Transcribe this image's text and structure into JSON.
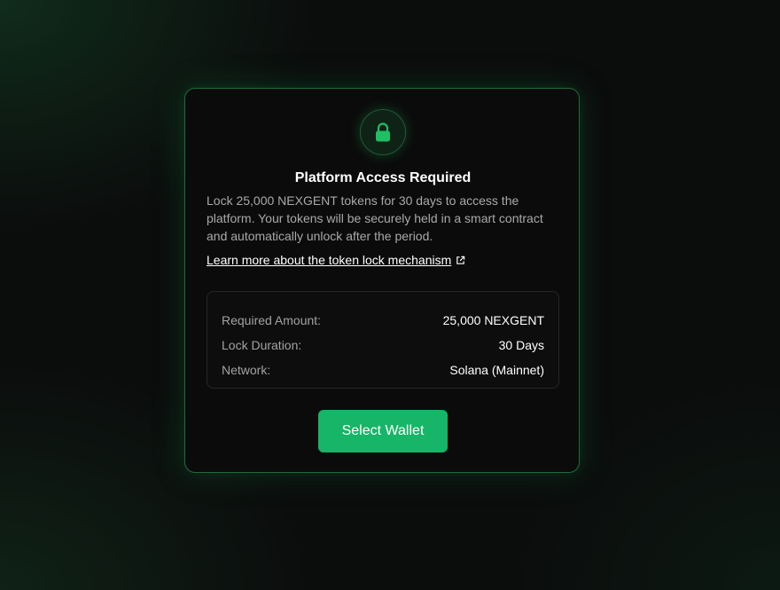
{
  "card": {
    "title": "Platform Access Required",
    "description": "Lock 25,000 NEXGENT tokens for 30 days to access the platform. Your tokens will be securely held in a smart contract and automatically unlock after the period.",
    "learn_more_link": "Learn more about the token lock mechanism",
    "lock_icon": "lock-icon",
    "external_link_icon": "external-link-icon"
  },
  "details": [
    {
      "label": "Required Amount:",
      "value": "25,000 NEXGENT"
    },
    {
      "label": "Lock Duration:",
      "value": "30 Days"
    },
    {
      "label": "Network:",
      "value": "Solana (Mainnet)"
    }
  ],
  "actions": {
    "select_wallet_label": "Select Wallet"
  },
  "colors": {
    "accent": "#16b567",
    "card_border": "#1e6b3a",
    "background": "#0b0c0c"
  }
}
